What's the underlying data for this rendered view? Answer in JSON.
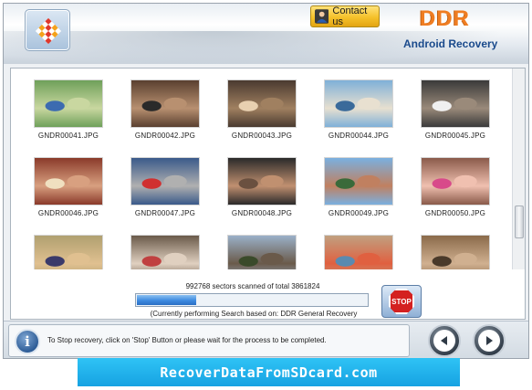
{
  "header": {
    "contact_label": "Contact us",
    "brand": "DDR",
    "product": "Android Recovery"
  },
  "files": [
    {
      "name": "GNDR00041.JPG"
    },
    {
      "name": "GNDR00042.JPG"
    },
    {
      "name": "GNDR00043.JPG"
    },
    {
      "name": "GNDR00044.JPG"
    },
    {
      "name": "GNDR00045.JPG"
    },
    {
      "name": "GNDR00046.JPG"
    },
    {
      "name": "GNDR00047.JPG"
    },
    {
      "name": "GNDR00048.JPG"
    },
    {
      "name": "GNDR00049.JPG"
    },
    {
      "name": "GNDR00050.JPG"
    },
    {
      "name": ""
    },
    {
      "name": ""
    },
    {
      "name": ""
    },
    {
      "name": ""
    },
    {
      "name": ""
    }
  ],
  "scan": {
    "summary": "992768 sectors scanned of total 3861824",
    "sectors_scanned": 992768,
    "sectors_total": 3861824,
    "status": "(Currently performing Search based on:  DDR General Recovery Procedure)",
    "stop_label": "STOP"
  },
  "footer": {
    "info": "To Stop recovery, click on 'Stop' Button or please wait for the process to be completed."
  },
  "banner": "RecoverDataFromSDcard.com",
  "colors": {
    "accent_orange": "#ef7d22",
    "progress_blue": "#3d8ae0",
    "banner_blue": "#1fb0ec",
    "stop_red": "#d42020"
  }
}
